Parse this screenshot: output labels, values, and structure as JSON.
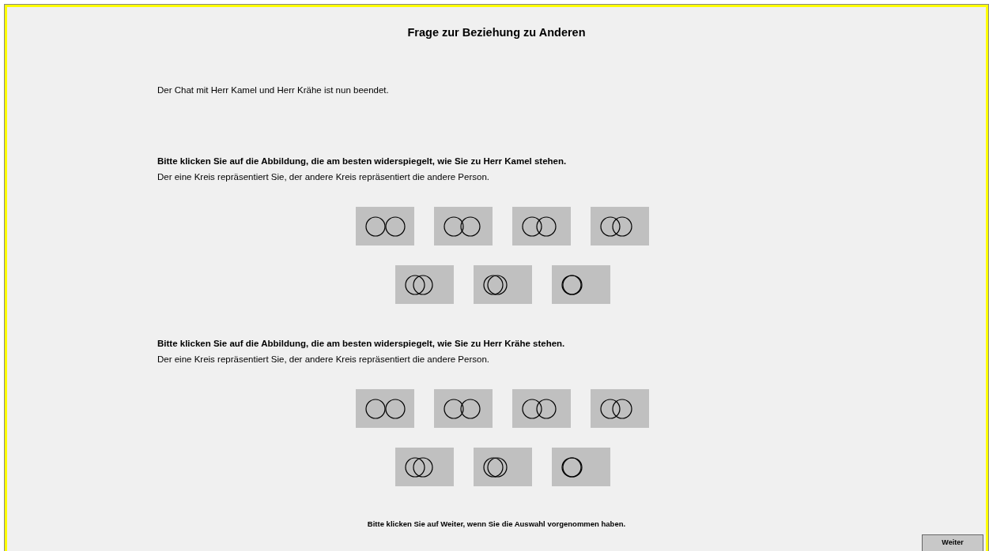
{
  "title": "Frage zur Beziehung zu Anderen",
  "intro": "Der Chat mit Herr Kamel und Herr Krähe ist nun beendet.",
  "questions": [
    {
      "prompt": "Bitte klicken Sie auf die Abbildung, die am besten widerspiegelt, wie Sie zu Herr Kamel stehen.",
      "hint": "Der eine Kreis repräsentiert Sie, der andere Kreis repräsentiert die andere Person.",
      "options": [
        {
          "selected": false
        },
        {
          "selected": false
        },
        {
          "selected": false
        },
        {
          "selected": false
        },
        {
          "selected": false
        },
        {
          "selected": false
        },
        {
          "selected": false
        }
      ]
    },
    {
      "prompt": "Bitte klicken Sie auf die Abbildung, die am besten widerspiegelt, wie Sie zu Herr Krähe stehen.",
      "hint": "Der eine Kreis repräsentiert Sie, der andere Kreis repräsentiert die andere Person.",
      "options": [
        {
          "selected": false
        },
        {
          "selected": false
        },
        {
          "selected": false
        },
        {
          "selected": false
        },
        {
          "selected": false
        },
        {
          "selected": false
        },
        {
          "selected": false
        }
      ]
    }
  ],
  "footer_note": "Bitte klicken Sie auf Weiter, wenn Sie die Auswahl vorgenommen haben.",
  "next_button": "Weiter"
}
